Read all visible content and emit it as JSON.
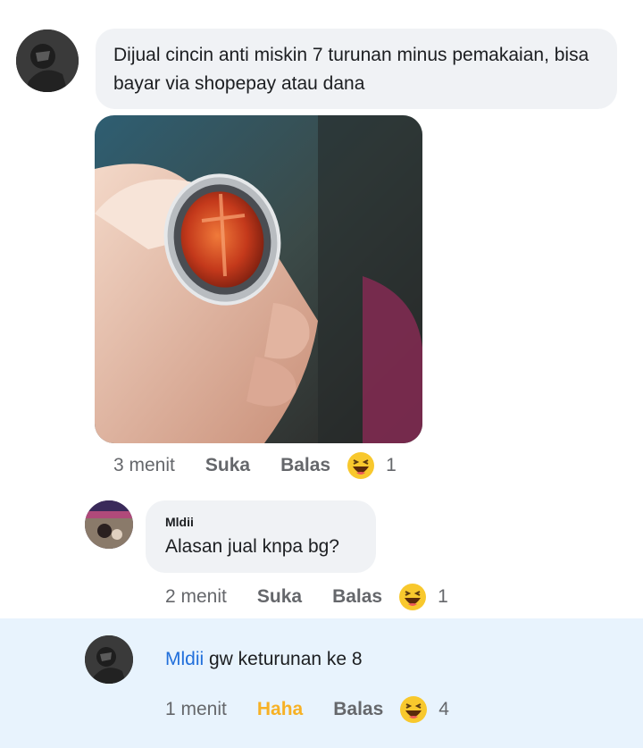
{
  "post": {
    "text": "Dijual cincin anti miskin 7 turunan minus pemakaian, bisa bayar via shopepay atau dana",
    "time": "3 menit",
    "like_label": "Suka",
    "reply_label": "Balas",
    "reaction_icon": "haha-emoji-icon",
    "reaction_count": "1"
  },
  "reply1": {
    "author": "Mldii",
    "text": "Alasan jual knpa bg?",
    "time": "2 menit",
    "like_label": "Suka",
    "reply_label": "Balas",
    "reaction_icon": "haha-emoji-icon",
    "reaction_count": "1"
  },
  "reply2": {
    "mention": "Mldii",
    "text": " gw keturunan ke 8",
    "time": "1 menit",
    "like_label": "Haha",
    "reply_label": "Balas",
    "reaction_icon": "haha-emoji-icon",
    "reaction_count": "4"
  },
  "colors": {
    "bubble": "#f0f2f5",
    "mention": "#216fdb",
    "haha_active": "#f7b125",
    "highlight": "#e8f3fd"
  }
}
